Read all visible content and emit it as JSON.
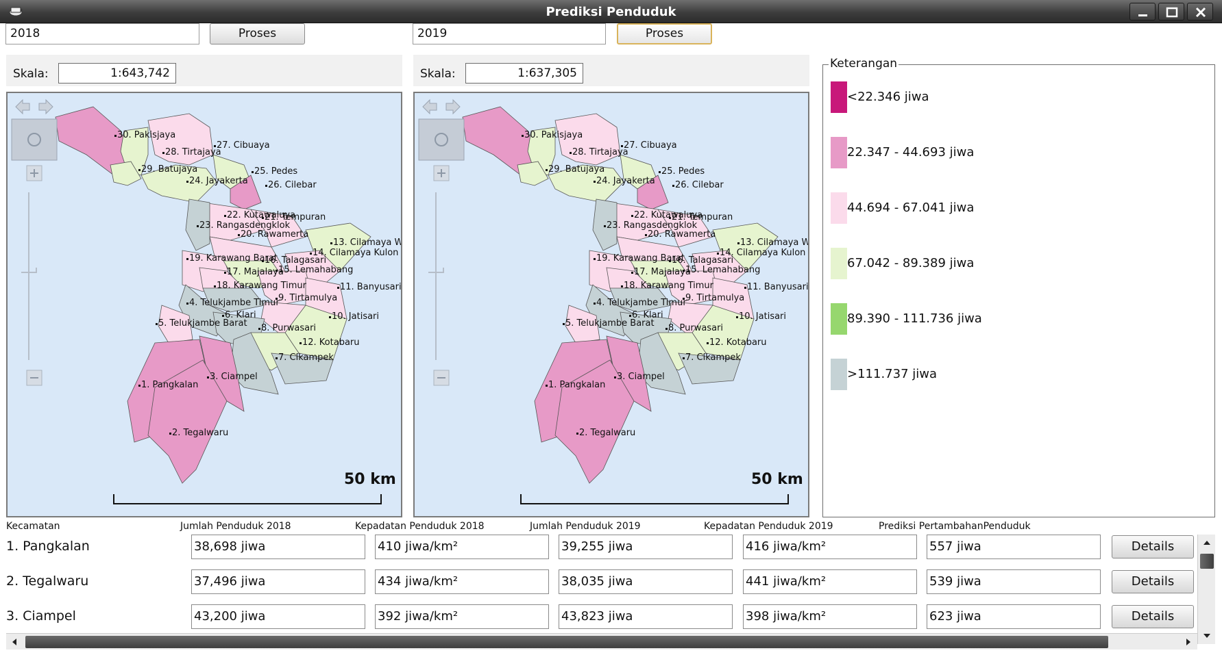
{
  "window": {
    "title": "Prediksi Penduduk",
    "controls": [
      "minimize-icon",
      "maximize-icon",
      "close-icon"
    ]
  },
  "left": {
    "year_value": "2018",
    "process_label": "Proses",
    "scale_label": "Skala:",
    "scale_value": "1:643,742",
    "scalebar_label": "50 km"
  },
  "right": {
    "year_value": "2019",
    "process_label": "Proses",
    "scale_label": "Skala:",
    "scale_value": "1:637,305",
    "scalebar_label": "50 km"
  },
  "map_labels": [
    "30. Pakisjaya",
    "28. Tirtajaya",
    "27. Cibuaya",
    "29. Batujaya",
    "25. Pedes",
    "24. Jayakerta",
    "26. Cilebar",
    "22. Kutawaluya",
    "21. Tempuran",
    "23. Rangasdengklok",
    "20. Rawamerta",
    "13. Cilamaya W",
    "14. Cilamaya Kulon",
    "19. Karawang Barat",
    "16. Talagasari",
    "17. Majalaya",
    "15. Lemahabang",
    "18. Karawang Timur",
    "11. Banyusari",
    "4. Telukjambe Timur",
    "9. Tirtamulya",
    "6. Klari",
    "10. Jatisari",
    "5. Telukjambe Barat",
    "8. Purwasari",
    "12. Kotabaru",
    "7. Cikampek",
    "3. Ciampel",
    "1. Pangkalan",
    "2. Tegalwaru"
  ],
  "legend": {
    "title": "Keterangan",
    "items": [
      {
        "label": "<22.346 jiwa",
        "color": "#c8187a"
      },
      {
        "label": "22.347 - 44.693 jiwa",
        "color": "#e79ac7"
      },
      {
        "label": "44.694 - 67.041 jiwa",
        "color": "#fbdbeb"
      },
      {
        "label": "67.042 - 89.389 jiwa",
        "color": "#e6f4cf"
      },
      {
        "label": "89.390 - 111.736 jiwa",
        "color": "#96d76e"
      },
      {
        "label": ">111.737 jiwa",
        "color": "#c5d2d5"
      }
    ]
  },
  "table": {
    "headers": [
      "Kecamatan",
      "Jumlah Penduduk 2018",
      "Kepadatan Penduduk 2018",
      "Jumlah Penduduk 2019",
      "Kepadatan Penduduk 2019",
      "Prediksi PertambahanPenduduk"
    ],
    "details_label": "Details",
    "rows": [
      {
        "name": "1. Pangkalan",
        "pop2018": "38,698 jiwa",
        "den2018": "410 jiwa/km²",
        "pop2019": "39,255 jiwa",
        "den2019": "416 jiwa/km²",
        "growth": "557 jiwa"
      },
      {
        "name": "2. Tegalwaru",
        "pop2018": "37,496 jiwa",
        "den2018": "434 jiwa/km²",
        "pop2019": "38,035 jiwa",
        "den2019": "441 jiwa/km²",
        "growth": "539 jiwa"
      },
      {
        "name": "3. Ciampel",
        "pop2018": "43,200 jiwa",
        "den2018": "392 jiwa/km²",
        "pop2019": "43,823 jiwa",
        "den2019": "398 jiwa/km²",
        "growth": "623 jiwa"
      }
    ]
  }
}
